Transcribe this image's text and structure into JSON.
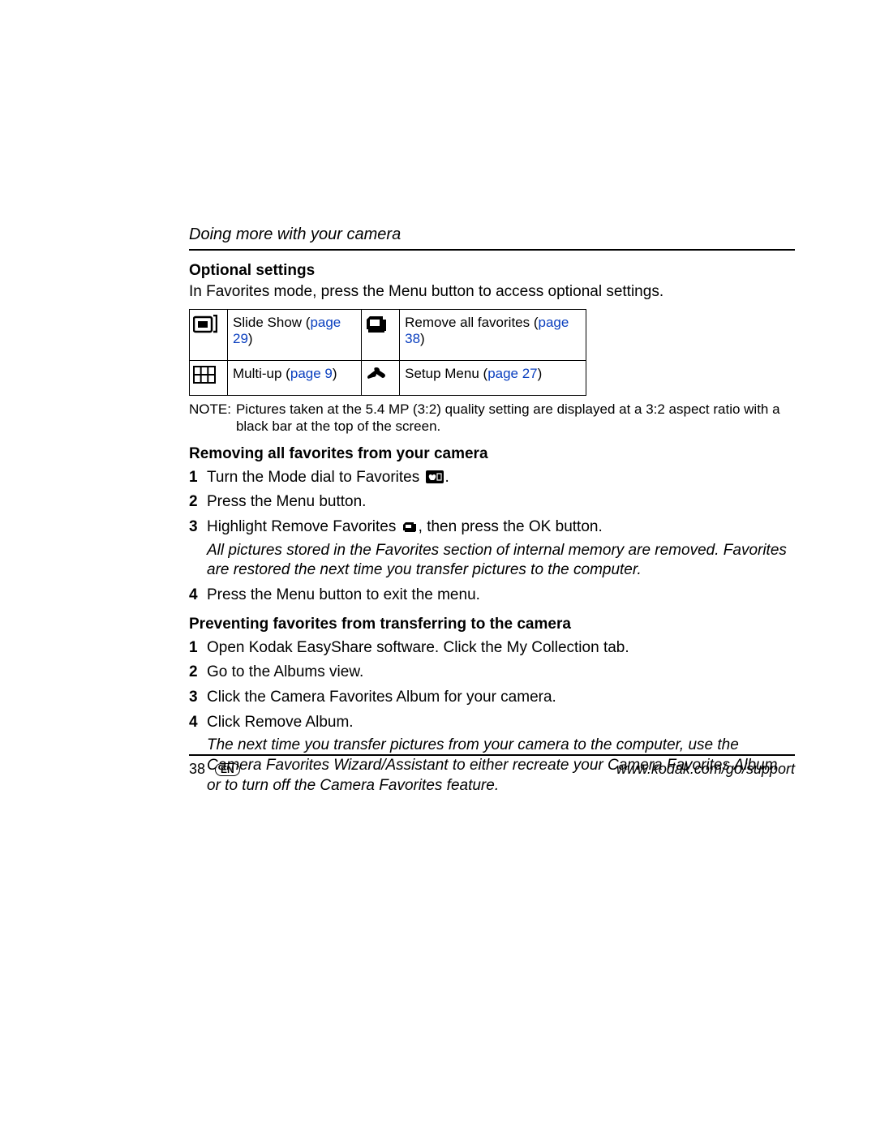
{
  "header": {
    "title": "Doing more with your camera"
  },
  "optional_settings": {
    "heading": "Optional settings",
    "intro": "In Favorites mode, press the Menu button to access optional settings.",
    "table": {
      "r1c1_label": "Slide Show (",
      "r1c1_link": "page 29",
      "r1c1_close": ")",
      "r1c2_label": "Remove all favorites (",
      "r1c2_link": "page 38",
      "r1c2_close": ")",
      "r2c1_label": "Multi-up (",
      "r2c1_link": "page 9",
      "r2c1_close": ")",
      "r2c2_label": "Setup Menu (",
      "r2c2_link": "page 27",
      "r2c2_close": ")"
    },
    "note_label": "NOTE:",
    "note_body": "Pictures taken at the 5.4 MP (3:2) quality setting are displayed at a 3:2 aspect ratio with a black bar at the top of the screen."
  },
  "removing": {
    "heading": "Removing all favorites from your camera",
    "steps": {
      "s1_pre": "Turn the Mode dial to Favorites ",
      "s1_post": ".",
      "s2": "Press the Menu button.",
      "s3_pre": "Highlight Remove Favorites ",
      "s3_post": ", then press the OK button.",
      "s3_italic": "All pictures stored in the Favorites section of internal memory are removed. Favorites are restored the next time you transfer pictures to the computer.",
      "s4": "Press the Menu button to exit the menu."
    }
  },
  "preventing": {
    "heading": "Preventing favorites from transferring to the camera",
    "steps": {
      "s1": "Open Kodak EasyShare software. Click the My Collection tab.",
      "s2": "Go to the Albums view.",
      "s3": "Click the Camera Favorites Album for your camera.",
      "s4": "Click Remove Album.",
      "s4_italic": "The next time you transfer pictures from your camera to the computer, use the Camera Favorites Wizard/Assistant to either recreate your Camera Favorites Album or to turn off the Camera Favorites feature."
    }
  },
  "footer": {
    "page_number": "38",
    "lang": "EN",
    "url": "www.kodak.com/go/support"
  },
  "nums": {
    "n1": "1",
    "n2": "2",
    "n3": "3",
    "n4": "4"
  }
}
